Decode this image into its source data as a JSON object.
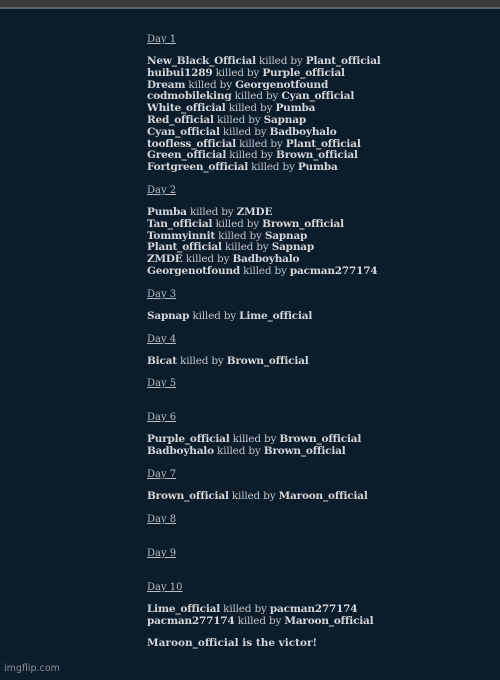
{
  "days": [
    {
      "label": "Day 1",
      "events": [
        {
          "victim": "New_Black_Official",
          "verb": "killed by",
          "killer": "Plant_official"
        },
        {
          "victim": "huibui1289",
          "verb": "killed by",
          "killer": "Purple_official"
        },
        {
          "victim": "Dream",
          "verb": "killed by",
          "killer": "Georgenotfound"
        },
        {
          "victim": "codmobileking",
          "verb": "killed by",
          "killer": "Cyan_official"
        },
        {
          "victim": "White_official",
          "verb": "killed by",
          "killer": "Pumba"
        },
        {
          "victim": "Red_official",
          "verb": "killed by",
          "killer": "Sapnap"
        },
        {
          "victim": "Cyan_official",
          "verb": "killed by",
          "killer": "Badboyhalo"
        },
        {
          "victim": "toofless_official",
          "verb": "killed by",
          "killer": "Plant_official"
        },
        {
          "victim": "Green_official",
          "verb": "killed by",
          "killer": "Brown_official"
        },
        {
          "victim": "Fortgreen_official",
          "verb": "killed by",
          "killer": "Pumba"
        }
      ]
    },
    {
      "label": "Day 2",
      "events": [
        {
          "victim": "Pumba",
          "verb": "killed by",
          "killer": "ZMDE"
        },
        {
          "victim": "Tan_official",
          "verb": "killed by",
          "killer": "Brown_official"
        },
        {
          "victim": "Tommyinnit",
          "verb": "killed by",
          "killer": "Sapnap"
        },
        {
          "victim": "Plant_official",
          "verb": "killed by",
          "killer": "Sapnap"
        },
        {
          "victim": "ZMDE",
          "verb": "killed by",
          "killer": "Badboyhalo"
        },
        {
          "victim": "Georgenotfound",
          "verb": "killed by",
          "killer": "pacman277174"
        }
      ]
    },
    {
      "label": "Day 3",
      "events": [
        {
          "victim": "Sapnap",
          "verb": "killed by",
          "killer": "Lime_official"
        }
      ]
    },
    {
      "label": "Day 4",
      "events": [
        {
          "victim": "Bicat",
          "verb": "killed by",
          "killer": "Brown_official"
        }
      ]
    },
    {
      "label": "Day 5",
      "events": []
    },
    {
      "label": "Day 6",
      "events": [
        {
          "victim": "Purple_official",
          "verb": "killed by",
          "killer": "Brown_official"
        },
        {
          "victim": "Badboyhalo",
          "verb": "killed by",
          "killer": "Brown_official"
        }
      ]
    },
    {
      "label": "Day 7",
      "events": [
        {
          "victim": "Brown_official",
          "verb": "killed by",
          "killer": "Maroon_official"
        }
      ]
    },
    {
      "label": "Day 8",
      "events": []
    },
    {
      "label": "Day 9",
      "events": []
    },
    {
      "label": "Day 10",
      "events": [
        {
          "victim": "Lime_official",
          "verb": "killed by",
          "killer": "pacman277174"
        },
        {
          "victim": "pacman277174",
          "verb": "killed by",
          "killer": "Maroon_official"
        }
      ]
    }
  ],
  "victor_text": "Maroon_official is the victor!",
  "watermark": "imgflip.com",
  "colors": {
    "background": "#0b1c2a",
    "topbar": "#3c3c3c",
    "text": "#c8ccd0"
  }
}
